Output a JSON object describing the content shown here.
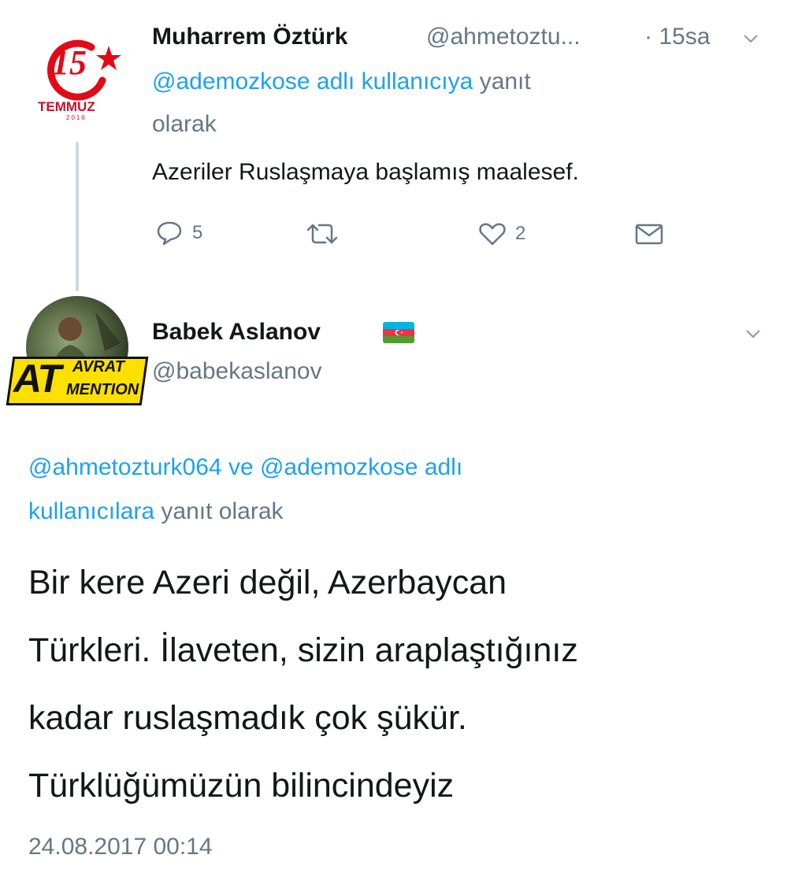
{
  "colors": {
    "link": "#1da1f2",
    "secondary": "#657786",
    "text": "#14171a",
    "thread_line": "#ccd6dd",
    "logo_red": "#e30a17"
  },
  "tweet1": {
    "avatar": {
      "logo_number": "15",
      "logo_word": "TEMMUZ",
      "logo_year": "2016",
      "icon": "15-temmuz-logo"
    },
    "name": "Muharrem Öztürk",
    "handle": "@ahmetoztu...",
    "time": "· 15sa",
    "reply_to_link": "@ademozkose adlı kullanıcıya",
    "reply_to_suffix1": "yanıt",
    "reply_to_suffix2": "olarak",
    "text": "Azeriler Ruslaşmaya başlamış maalesef.",
    "actions": {
      "reply_count": "5",
      "retweet_count": "",
      "like_count": "2"
    }
  },
  "tweet2": {
    "avatar": {
      "watermark_line1": "AT",
      "watermark_line2": "AVRAT",
      "watermark_line3": "MENTION",
      "icon": "profile-photo"
    },
    "name": "Babek Aslanov",
    "flag_icon": "azerbaijan-flag-icon",
    "handle": "@babekaslanov",
    "reply_link1": "@ahmetozturk064",
    "reply_and": "ve",
    "reply_link2": "@ademozkose adlı",
    "reply_link3": "kullanıcılara",
    "reply_suffix": "yanıt olarak",
    "text_lines": [
      "Bir kere Azeri değil, Azerbaycan",
      "Türkleri. İlaveten, sizin araplaştığınız",
      "kadar ruslaşmadık çok şükür.",
      "Türklüğümüzün bilincindeyiz"
    ],
    "timestamp": "24.08.2017 00:14"
  }
}
